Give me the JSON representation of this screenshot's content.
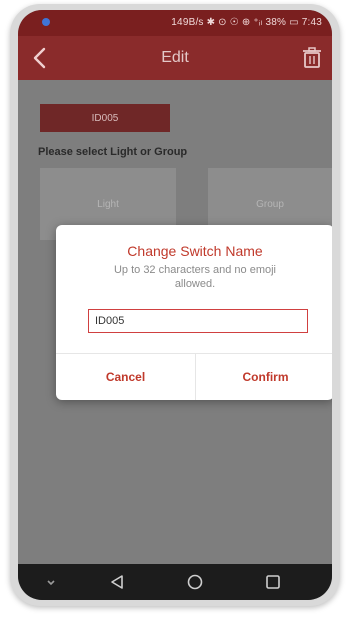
{
  "status_bar": {
    "text": "149B/s ✱ ⊙ ☉ ⊕ ⁺ᵢₗ 38% ▭ 7:43"
  },
  "app_bar": {
    "title": "Edit"
  },
  "content": {
    "id_tab": "ID005",
    "select_label": "Please select Light or Group",
    "options": [
      {
        "label": "Light"
      },
      {
        "label": "Group"
      }
    ]
  },
  "dialog": {
    "title": "Change Switch Name",
    "hint": "Up to 32 characters and no emoji allowed.",
    "input_value": "ID005",
    "cancel_label": "Cancel",
    "confirm_label": "Confirm"
  },
  "colors": {
    "app_bar": "#8a2b2b",
    "accent": "#c0392b"
  }
}
